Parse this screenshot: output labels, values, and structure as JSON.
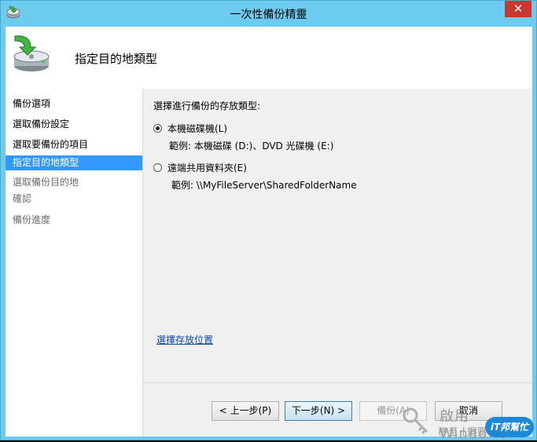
{
  "window": {
    "title": "一次性備份精靈",
    "close_glyph": "✕"
  },
  "header": {
    "title": "指定目的地類型",
    "icon": "backup-drive-icon"
  },
  "nav": {
    "items": [
      {
        "label": "備份選項",
        "state": "done"
      },
      {
        "label": "選取備份設定",
        "state": "done"
      },
      {
        "label": "選取要備份的項目",
        "state": "done"
      },
      {
        "label": "指定目的地類型",
        "state": "current"
      },
      {
        "label": "選取備份目的地",
        "state": "pending"
      },
      {
        "label": "確認",
        "state": "pending"
      },
      {
        "label": "備份進度",
        "state": "pending"
      }
    ]
  },
  "main": {
    "prompt": "選擇進行備份的存放類型:",
    "options": [
      {
        "label": "本機磁碟機(L)",
        "example": "範例: 本機磁碟 (D:)、DVD 光碟機 (E:)",
        "checked": true
      },
      {
        "label": "遠端共用資料夾(E)",
        "example": "範例: \\\\MyFileServer\\SharedFolderName",
        "checked": false
      }
    ],
    "link": "選擇存放位置"
  },
  "buttons": {
    "prev": "< 上一步(P)",
    "next": "下一步(N) >",
    "backup": "備份(A)",
    "cancel": "取消"
  },
  "watermark": {
    "line1": "啟用 Windows",
    "line2": "移至 [重要...",
    "logo": "iT邦幫忙"
  },
  "colors": {
    "title_bar": "#6ecbf0",
    "close_button": "#c7392f",
    "nav_selected": "#3399ff",
    "link": "#0d47a8"
  }
}
